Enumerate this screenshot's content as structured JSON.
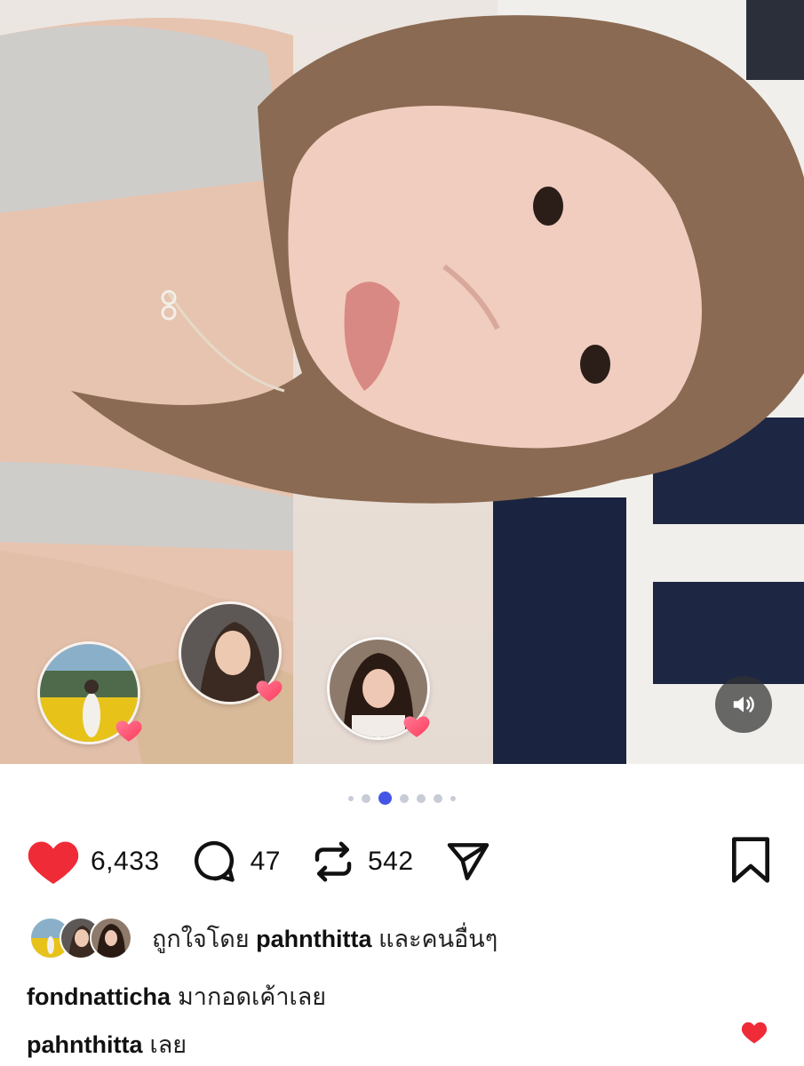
{
  "media": {
    "description_icon": "selfie-photo",
    "carousel": {
      "total": 7,
      "active_index": 2
    },
    "reactions": [
      {
        "name": "reaction-avatar-1",
        "icon": "heart-icon"
      },
      {
        "name": "reaction-avatar-2",
        "icon": "heart-icon"
      },
      {
        "name": "reaction-avatar-3",
        "icon": "heart-icon"
      }
    ],
    "mute_icon": "speaker-icon"
  },
  "actions": {
    "likes": "6,433",
    "comments": "47",
    "reposts": "542"
  },
  "liked_by": {
    "prefix": "ถูกใจโดย",
    "user": "pahnthitta",
    "suffix": "และคนอื่นๆ"
  },
  "comments": [
    {
      "user": "fondnatticha",
      "text": "มากอดเค้าเลย"
    },
    {
      "user": "pahnthitta",
      "text": "เลย"
    }
  ],
  "colors": {
    "like_red": "#ef2b37",
    "active_dot": "#4455e6"
  }
}
